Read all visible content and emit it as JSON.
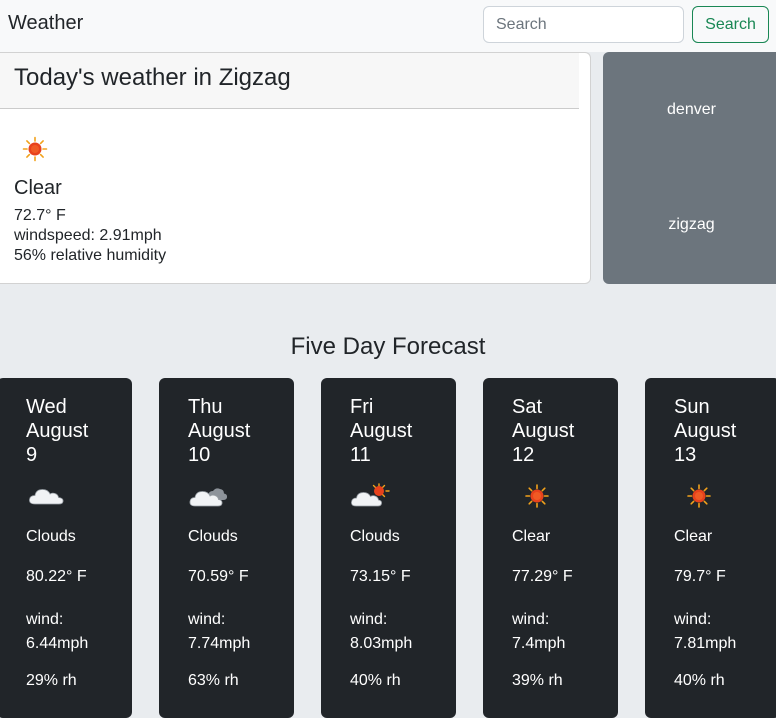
{
  "navbar": {
    "brand": "Weather",
    "search_placeholder": "Search",
    "search_value": "",
    "search_button": "Search"
  },
  "today": {
    "title": "Today's weather in Zigzag",
    "icon": "sun-icon",
    "condition": "Clear",
    "temperature": "72.7° F",
    "wind": "windspeed: 2.91mph",
    "humidity": "56% relative humidity"
  },
  "history": [
    "denver",
    "zigzag"
  ],
  "forecast": {
    "title": "Five Day Forecast",
    "days": [
      {
        "weekday": "Wed",
        "month": "August",
        "day": "9",
        "icon": "clouds-icon",
        "condition": "Clouds",
        "temp": "80.22° F",
        "wind_label": "wind:",
        "wind": "6.44mph",
        "humidity": "29% rh"
      },
      {
        "weekday": "Thu",
        "month": "August",
        "day": "10",
        "icon": "broken-clouds-icon",
        "condition": "Clouds",
        "temp": "70.59° F",
        "wind_label": "wind:",
        "wind": "7.74mph",
        "humidity": "63% rh"
      },
      {
        "weekday": "Fri",
        "month": "August",
        "day": "11",
        "icon": "few-clouds-icon",
        "condition": "Clouds",
        "temp": "73.15° F",
        "wind_label": "wind:",
        "wind": "8.03mph",
        "humidity": "40% rh"
      },
      {
        "weekday": "Sat",
        "month": "August",
        "day": "12",
        "icon": "sun-icon",
        "condition": "Clear",
        "temp": "77.29° F",
        "wind_label": "wind:",
        "wind": "7.4mph",
        "humidity": "39% rh"
      },
      {
        "weekday": "Sun",
        "month": "August",
        "day": "13",
        "icon": "sun-icon",
        "condition": "Clear",
        "temp": "79.7° F",
        "wind_label": "wind:",
        "wind": "7.81mph",
        "humidity": "40% rh"
      }
    ]
  }
}
